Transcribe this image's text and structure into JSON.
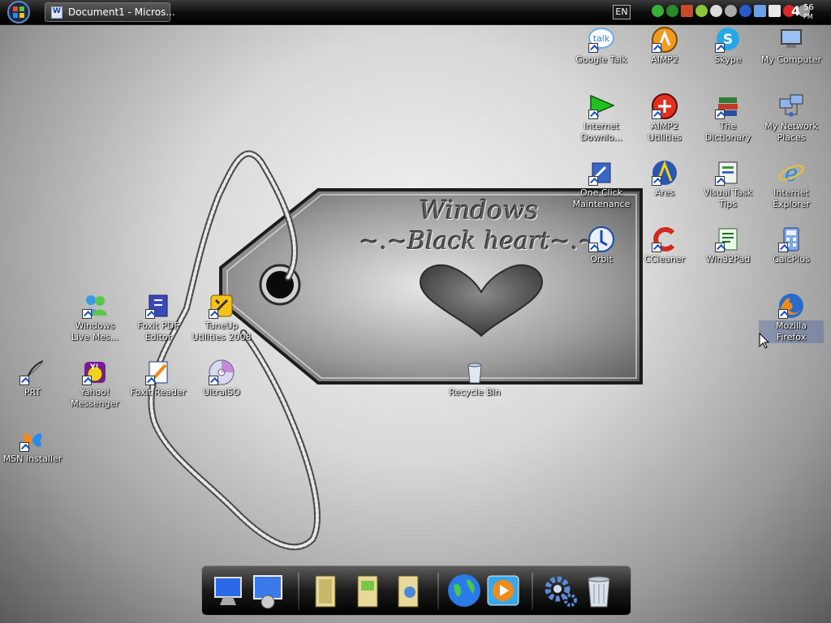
{
  "taskbar": {
    "task_button_label": "Document1 - Micros...",
    "language": "EN",
    "clock": {
      "hour": "4",
      "minute": "56",
      "ampm": "PM"
    },
    "tray_icons": [
      "talk-tray-icon",
      "shield-tray-icon",
      "network-tray-icon",
      "update-tray-icon",
      "toggle-tray-icon",
      "gear-tray-icon",
      "download-tray-icon",
      "monitor-tray-icon",
      "folder-tray-icon",
      "close-tray-icon",
      "chat-tray-icon"
    ]
  },
  "desktop_icons": {
    "google_talk": "Google Talk",
    "aimp2": "AIMP2",
    "skype": "Skype",
    "my_computer": "My Computer",
    "internet_download_1": "Internet",
    "internet_download_2": "Downlo...",
    "aimp2_utilities_1": "AIMP2",
    "aimp2_utilities_2": "Utilities",
    "dictionary_1": "The",
    "dictionary_2": "Dictionary",
    "network_places_1": "My Network",
    "network_places_2": "Places",
    "one_click_1": "One Click",
    "one_click_2": "Maintenance",
    "ares": "Ares",
    "visual_task_1": "Visual Task",
    "visual_task_2": "Tips",
    "ie_1": "Internet",
    "ie_2": "Explorer",
    "orbit": "Orbit",
    "ccleaner": "CCleaner",
    "win32pad": "Win32Pad",
    "calcplus": "CalcPlus",
    "firefox_1": "Mozilla",
    "firefox_2": "Firefox",
    "wlm_1": "Windows",
    "wlm_2": "Live Mes...",
    "foxit_pdf_1": "Foxit PDF",
    "foxit_pdf_2": "Editor",
    "tuneup_1": "TuneUp",
    "tuneup_2": "Utilities 2008",
    "prt": "PRT",
    "yahoo_1": "Yahoo!",
    "yahoo_2": "Messenger",
    "foxit_reader": "Foxit Reader",
    "ultraiso": "UltraISO",
    "recycle_bin": "Recycle Bin",
    "msn_installer": "MSN Installer"
  },
  "wallpaper": {
    "line1": "Windows",
    "line2": "~.~Black heart~.~"
  },
  "colors": {
    "taskbar": "#0c0c0c",
    "accent_blue": "#1550c8"
  }
}
